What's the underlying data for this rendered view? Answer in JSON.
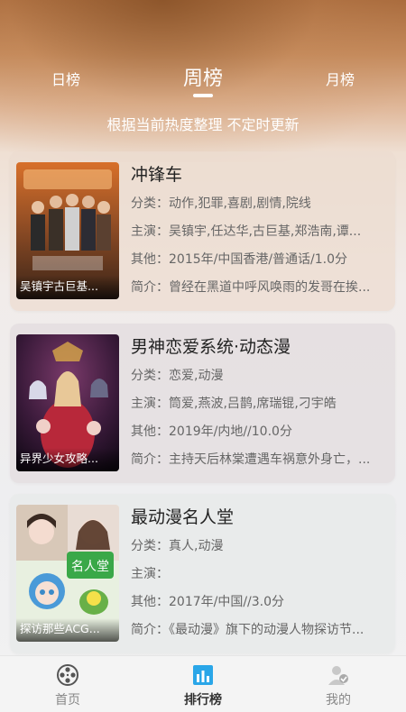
{
  "tabs": {
    "day": "日榜",
    "week": "周榜",
    "month": "月榜",
    "active": "week"
  },
  "subtitle": "根据当前热度整理 不定时更新",
  "items": [
    {
      "title": "冲锋车",
      "poster_caption": "吴镇宇古巨基...",
      "category": "分类：动作,犯罪,喜剧,剧情,院线",
      "cast": "主演：吴镇宇,任达华,古巨基,郑浩南,谭...",
      "other": "其他：2015年/中国香港/普通话/1.0分",
      "intro": "简介：曾经在黑道中呼风唤雨的发哥在挨..."
    },
    {
      "title": "男神恋爱系统·动态漫",
      "poster_caption": "异界少女攻略...",
      "category": "分类：恋爱,动漫",
      "cast": "主演：筒爱,燕波,吕鹊,席瑞锟,刁宇皓",
      "other": "其他：2019年/内地//10.0分",
      "intro": "简介：主持天后林棠遭遇车祸意外身亡，..."
    },
    {
      "title": "最动漫名人堂",
      "poster_caption": "探访那些ACG...",
      "category": "分类：真人,动漫",
      "cast": "主演：",
      "other": "其他：2017年/中国//3.0分",
      "intro": "简介：《最动漫》旗下的动漫人物探访节..."
    }
  ],
  "bottom_nav": [
    {
      "label": "首页",
      "icon": "film-reel-icon"
    },
    {
      "label": "排行榜",
      "icon": "ranking-chart-icon"
    },
    {
      "label": "我的",
      "icon": "user-profile-icon"
    }
  ],
  "colors": {
    "accent_blue": "#2aa6e8",
    "header_warm": "#b7764a"
  }
}
